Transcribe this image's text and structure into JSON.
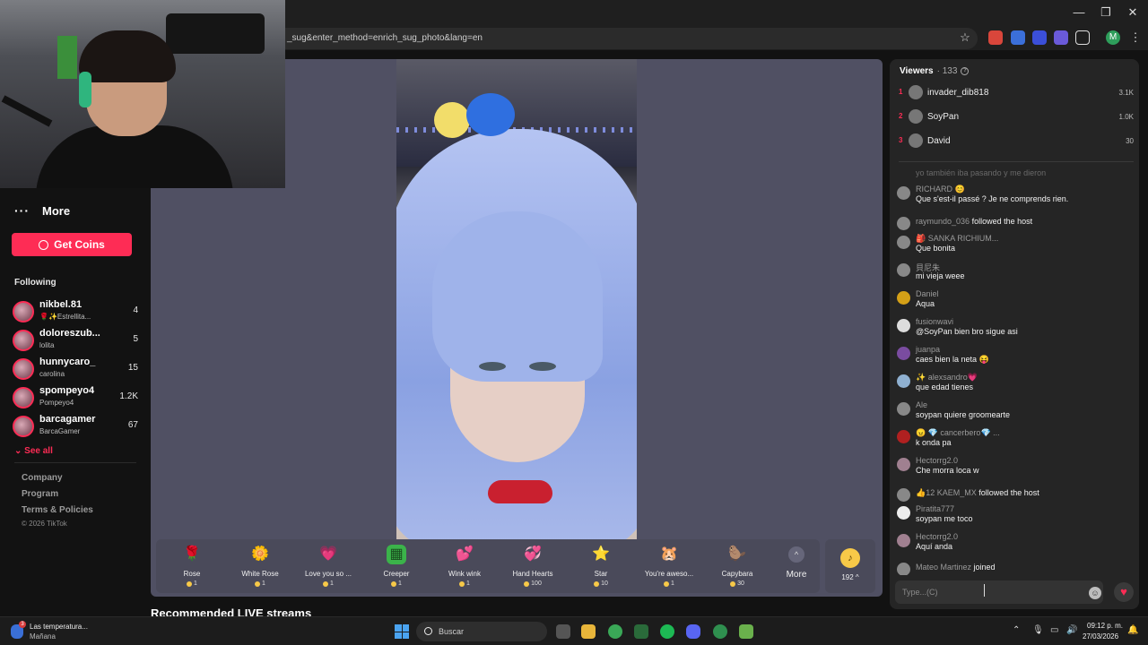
{
  "browser": {
    "url_text": "_sug&enter_method=enrich_sug_photo&lang=en",
    "profile_initial": "M",
    "window_minimize": "—",
    "window_restore": "❐",
    "window_close": "✕"
  },
  "sidebar": {
    "more_label": "More",
    "get_coins_label": "Get Coins",
    "following_title": "Following",
    "following": [
      {
        "name": "nikbel.81",
        "sub": "🌹✨Estrellita...",
        "count": "4"
      },
      {
        "name": "doloreszub...",
        "sub": "lolita",
        "count": "5"
      },
      {
        "name": "hunnycaro_",
        "sub": "carolina",
        "count": "15"
      },
      {
        "name": "spompeyo4",
        "sub": "Pompeyo4",
        "count": "1.2K"
      },
      {
        "name": "barcagamer",
        "sub": "BarcaGamer",
        "count": "67"
      }
    ],
    "see_all_label": "See all",
    "footer_links": [
      "Company",
      "Program",
      "Terms & Policies"
    ],
    "copyright": "© 2026 TikTok"
  },
  "gifts": [
    {
      "name": "Rose",
      "cost": "1",
      "icon": "🌹",
      "color": "#ff5b7a"
    },
    {
      "name": "White Rose",
      "cost": "1",
      "icon": "🌼",
      "color": "#f4f0da"
    },
    {
      "name": "Love you so ...",
      "cost": "1",
      "icon": "💗",
      "color": "#ff4d6d"
    },
    {
      "name": "Creeper",
      "cost": "1",
      "icon": "▦",
      "color": "#3bb34a"
    },
    {
      "name": "Wink wink",
      "cost": "1",
      "icon": "💕",
      "color": "#ff6fb5"
    },
    {
      "name": "Hand Hearts",
      "cost": "100",
      "icon": "💞",
      "color": "#ff8fc8"
    },
    {
      "name": "Star",
      "cost": "10",
      "icon": "⭐",
      "color": "#ffe066"
    },
    {
      "name": "You're aweso...",
      "cost": "1",
      "icon": "🐹",
      "color": "#d7a06a"
    },
    {
      "name": "Capybara",
      "cost": "30",
      "icon": "🦫",
      "color": "#a86a3c"
    }
  ],
  "gift_more": {
    "label": "More",
    "chevron": "^"
  },
  "coin_balance": "192 ^",
  "coin_icon": "tiktok-coin-icon",
  "recommended_title": "Recommended LIVE streams",
  "chat": {
    "viewers_label": "Viewers",
    "viewers_count": "· 133",
    "top_viewers": [
      {
        "rank": "1",
        "name": "invader_dib818",
        "score": "3.1K"
      },
      {
        "rank": "2",
        "name": "SoyPan",
        "score": "1.0K"
      },
      {
        "rank": "3",
        "name": "David",
        "score": "30"
      }
    ],
    "faded_message": "yo también iba pasando y me dieron",
    "messages": [
      {
        "user": "RICHARD 😊",
        "text": "Que s'est-il passé ? Je ne comprends rien."
      },
      {
        "inline_user": "raymundo_036",
        "inline_text": "followed the host"
      },
      {
        "user": "🎒 SANKA RICHIUM...",
        "text": "Que bonita"
      },
      {
        "user": "貝尼朱",
        "text": "mi vieja weee"
      },
      {
        "user": "Daniel",
        "text": "Aqua"
      },
      {
        "user": "fusionwavi",
        "text": "@SoyPan bien bro sigue asi"
      },
      {
        "user": "juanpa",
        "text": "caes bien la neta 😝"
      },
      {
        "user": "✨ alexsandro💗",
        "text": "que edad tienes"
      },
      {
        "user": "Ale",
        "text": "soypan quiere groomearte"
      },
      {
        "user": "😠 💎 cancerbero💎 ...",
        "text": "k onda pa"
      },
      {
        "user": "Hectorrg2.0",
        "text": "Che morra loca w"
      },
      {
        "inline_user": "👍12 KAEM_MX",
        "inline_text": "followed the host"
      },
      {
        "user": "Piratita777",
        "text": "soypan me toco"
      },
      {
        "user": "Hectorrg2.0",
        "text": "Aquí anda"
      },
      {
        "inline_user": "Mateo Martinez",
        "inline_text": "joined"
      }
    ],
    "input_placeholder": "Type...(C)"
  },
  "taskbar": {
    "weather_title": "Las temperatura...",
    "weather_sub": "Mañana",
    "weather_badge": "3",
    "search_label": "Buscar",
    "time": "09:12 p. m.",
    "date": "27/03/2026"
  },
  "colors": {
    "accent": "#fe2c55",
    "background": "#121212",
    "chat_panel": "#252525",
    "stream_bg": "#505063"
  }
}
